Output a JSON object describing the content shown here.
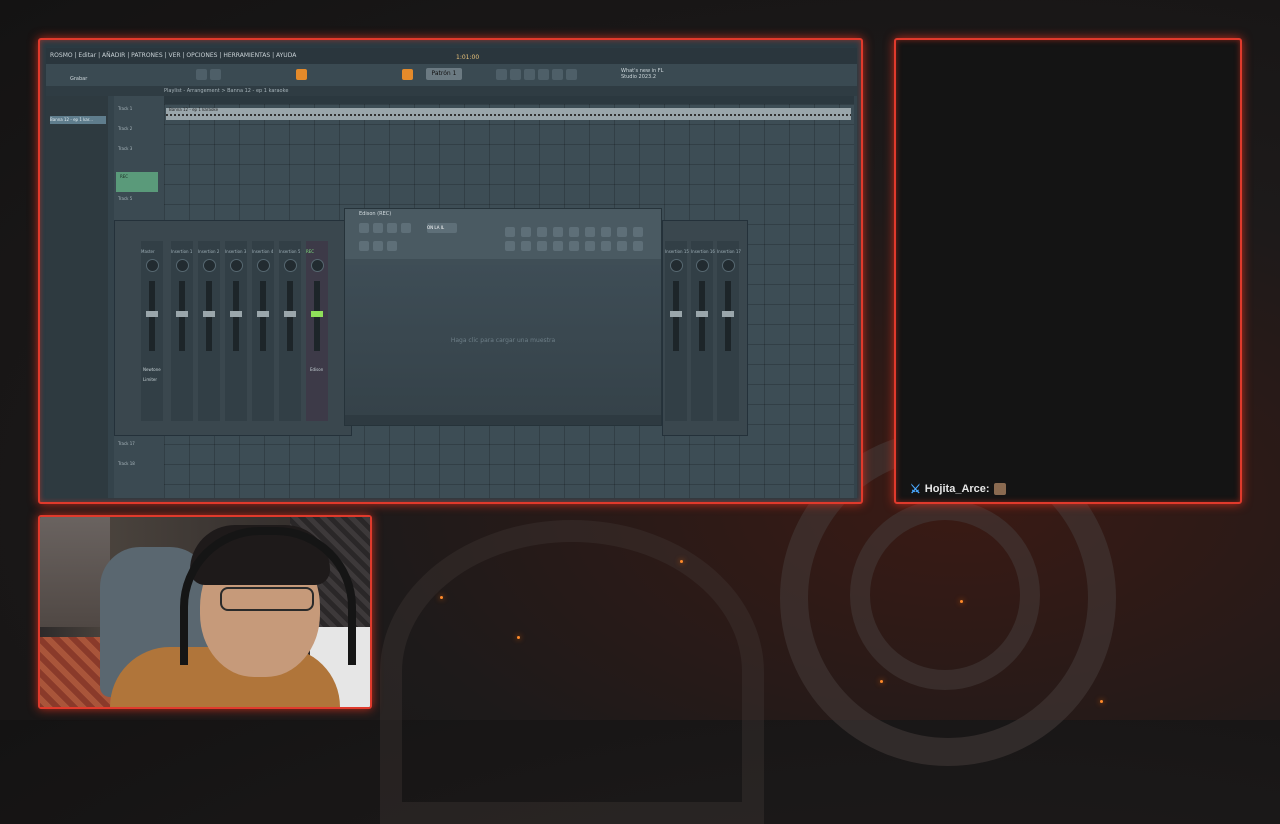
{
  "daw": {
    "menu": "ROSMO | Editar | AÑADIR | PATRONES | VER | OPCIONES | HERRAMIENTAS | AYUDA",
    "record_label": "Grabar",
    "pattern": "Patrón 1",
    "tempo": "1:01:00",
    "info": "What's new in FL Studio 2023.2",
    "playlist_title": "Playlist - Arrangement > Banna 12 - ep 1 karaoke",
    "browser_item": "Banna 12 - ep 1 kar...",
    "clip_label": "Banna 12 - ep 1 karaoke",
    "tracks": [
      "Track 1",
      "Track 2",
      "Track 3",
      "Track 4",
      "Track 5",
      "Track 17",
      "Track 18"
    ],
    "rec_label": "REC",
    "mixer": {
      "strips": [
        "Master",
        "Insertion 1",
        "Insertion 2",
        "Insertion 3",
        "Insertion 4",
        "Insertion 5",
        "REC"
      ],
      "right_strips": [
        "Insertion 15",
        "Insertion 16",
        "Insertion 17"
      ],
      "master_name": "Newtone",
      "master_sub": "Limiter",
      "rec_name": "Edison"
    },
    "edison": {
      "title": "Edison (REC)",
      "mode": "ON LA IL",
      "hint": "Haga clic para cargar una muestra"
    }
  },
  "chat": {
    "username": "Hojita_Arce:",
    "badge_icon": "sword-icon",
    "emote_icon": "emote-icon"
  },
  "colors": {
    "frame_accent": "#e03a2c",
    "username_color": "#e6e6e6"
  }
}
